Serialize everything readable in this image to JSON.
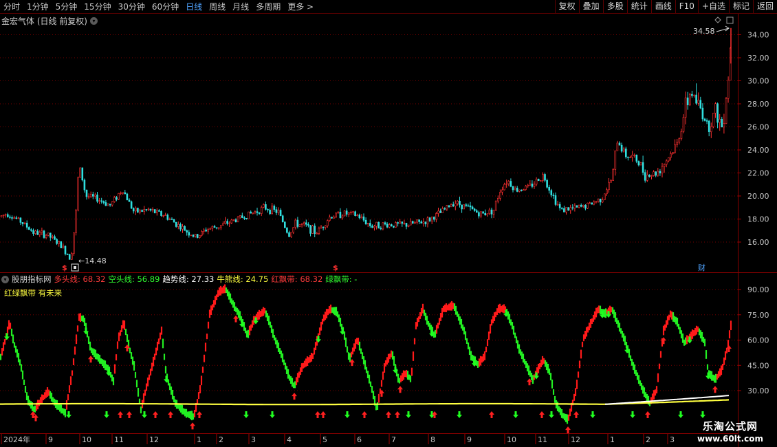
{
  "toolbar": {
    "periods": [
      "分时",
      "1分钟",
      "5分钟",
      "15分钟",
      "30分钟",
      "60分钟",
      "日线",
      "周线",
      "月线",
      "多周期",
      "更多 >"
    ],
    "active_period": "日线",
    "tools": [
      "复权",
      "叠加",
      "多股",
      "统计",
      "画线",
      "F10",
      "+自选",
      "标记",
      "返回"
    ]
  },
  "stock_panel": {
    "title": "金宏气体 (日线 前复权)",
    "price_ticks": [
      "34.00",
      "32.00",
      "30.00",
      "28.00",
      "26.00",
      "24.00",
      "22.00",
      "20.00",
      "18.00",
      "16.00"
    ],
    "high_label": "34.58",
    "low_label": "14.48",
    "event_markers": [
      "$",
      "$"
    ],
    "finance_marker": "财"
  },
  "indicator_panel": {
    "source": "股朋指标网",
    "fields": [
      {
        "label": "多头线:",
        "value": "68.32",
        "color": "#ff3b3b"
      },
      {
        "label": "空头线:",
        "value": "56.89",
        "color": "#30ff30"
      },
      {
        "label": "趋势线:",
        "value": "27.33",
        "color": "#ffffff"
      },
      {
        "label": "牛熊线:",
        "value": "24.75",
        "color": "#ffff40"
      },
      {
        "label": "红飘带:",
        "value": "68.32",
        "color": "#ff3b3b"
      },
      {
        "label": "绿飘带:",
        "value": "-",
        "color": "#30ff30"
      }
    ],
    "subtitle": "红绿飘带 有未来",
    "value_ticks": [
      "90.00",
      "75.00",
      "60.00",
      "45.00",
      "30.00"
    ]
  },
  "time_axis": {
    "labels": [
      "2024年",
      "9",
      "10",
      "11",
      "12",
      "1",
      "2",
      "3",
      "4",
      "5",
      "6",
      "7",
      "8",
      "9",
      "10",
      "11",
      "12",
      "1",
      "2",
      "3"
    ]
  },
  "watermark": {
    "name": "乐淘公式网",
    "url": "www.60lt.com"
  },
  "colors": {
    "up": "#ff3030",
    "down": "#30e0e0",
    "grid": "#7a0000",
    "ribbon_red": "#ff1a1a",
    "ribbon_green": "#22ee22",
    "trend_line": "#ffffff",
    "bull_bear_line": "#ffff40"
  }
}
